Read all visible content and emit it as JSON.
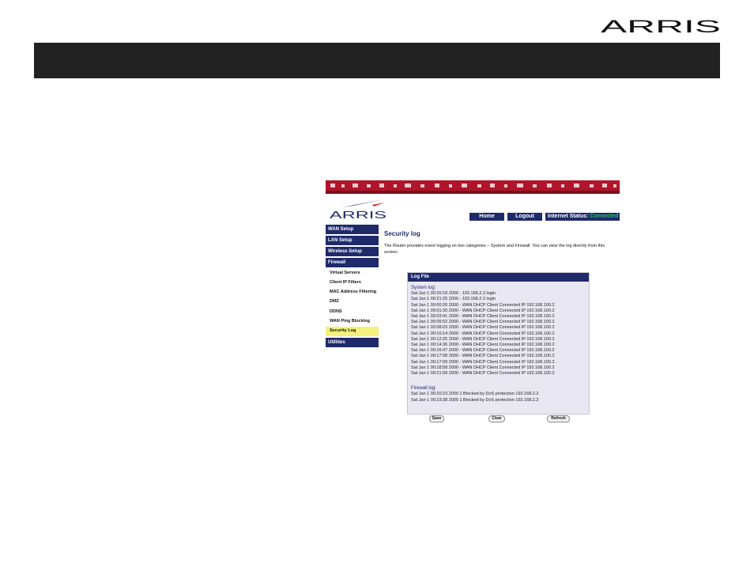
{
  "document": {
    "brand": "ARRIS"
  },
  "screenshot": {
    "brand": "ARRIS",
    "header": {
      "home_label": "Home",
      "logout_label": "Logout",
      "status_label": "Internet Status:",
      "status_value": "Connected",
      "status_color": "#22c55e"
    },
    "sidebar": {
      "wan": "WAN Setup",
      "lan": "LAN Setup",
      "wireless": "Wireless Setup",
      "firewall": "Firewall",
      "sub": [
        "Virtual Servers",
        "Client IP Filters",
        "MAC Address Filtering",
        "DMZ",
        "DDNS",
        "WAN Ping Blocking",
        "Security Log"
      ],
      "utilities": "Utilities"
    },
    "page_title": "Security log",
    "description": "The Router provides event logging on two categories – System and Firewall. You can view the log directly from this screen.",
    "log": {
      "header": "Log File",
      "system_label": "System log:",
      "system_entries": [
        "Sat Jan 1 00:20:18 2000 - 192.168.2.2 login",
        "Sat Jan 1 00:21:25 2000 - 192.168.2.2 login",
        "Sat Jan 1 00:00:20 2000 - WAN DHCP Client Connected IP 192.168.100.2",
        "Sat Jan 1 00:01:30 2000 - WAN DHCP Client Connected IP 192.168.100.2",
        "Sat Jan 1 00:03:41 2000 - WAN DHCP Client Connected IP 192.168.100.2",
        "Sat Jan 1 00:05:52 2000 - WAN DHCP Client Connected IP 192.168.100.2",
        "Sat Jan 1 00:08:03 2000 - WAN DHCP Client Connected IP 192.168.100.2",
        "Sat Jan 1 00:10:14 2000 - WAN DHCP Client Connected IP 192.168.100.2",
        "Sat Jan 1 00:12:25 2000 - WAN DHCP Client Connected IP 192.168.100.2",
        "Sat Jan 1 00:14:36 2000 - WAN DHCP Client Connected IP 192.168.100.2",
        "Sat Jan 1 00:16:47 2000 - WAN DHCP Client Connected IP 192.168.100.2",
        "Sat Jan 1 00:17:08 2000 - WAN DHCP Client Connected IP 192.168.100.2",
        "Sat Jan 1 00:17:09 2000 - WAN DHCP Client Connected IP 192.168.100.2",
        "Sat Jan 1 00:18:58 2000 - WAN DHCP Client Connected IP 192.168.100.2",
        "Sat Jan 1 00:21:09 2000 - WAN DHCP Client Connected IP 192.168.100.2"
      ],
      "firewall_label": "Firewall log:",
      "firewall_entries": [
        "Sat Jan 1 00:20:23 2000 1 Blocked by DoS protection 192.168.2.2",
        "Sat Jan 1 00:23:38 2000 1 Blocked by DoS protection 192.168.2.2"
      ]
    },
    "buttons": {
      "save": "Save",
      "clear": "Clear",
      "refresh": "Refresh"
    }
  }
}
